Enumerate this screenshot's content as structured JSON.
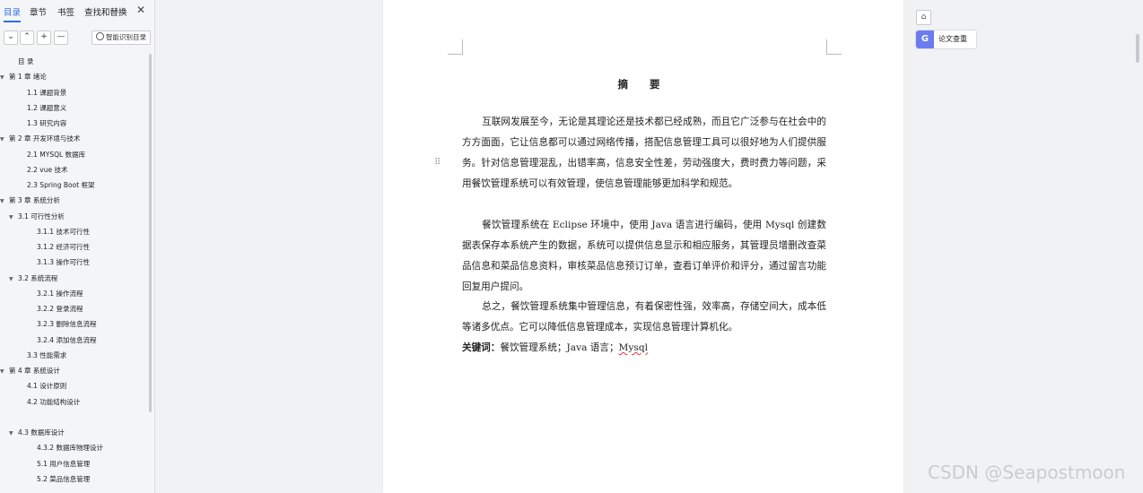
{
  "nav": {
    "tabs": [
      "目录",
      "章节",
      "书签",
      "查找和替换"
    ],
    "close_icon": "✕",
    "smart_button": "智能识别目录",
    "toc": [
      {
        "label": "目  录",
        "level": 1,
        "arrow": false
      },
      {
        "label": "第 1 章  绪论",
        "level": 0,
        "arrow": true
      },
      {
        "label": "1.1  课题背景",
        "level": 2,
        "arrow": false
      },
      {
        "label": "1.2  课题意义",
        "level": 2,
        "arrow": false
      },
      {
        "label": "1.3  研究内容",
        "level": 2,
        "arrow": false
      },
      {
        "label": "第 2 章  开发环境与技术",
        "level": 0,
        "arrow": true
      },
      {
        "label": "2.1 MYSQL 数据库",
        "level": 2,
        "arrow": false
      },
      {
        "label": "2.2 vue 技术",
        "level": 2,
        "arrow": false
      },
      {
        "label": "2.3 Spring Boot 框架",
        "level": 2,
        "arrow": false
      },
      {
        "label": "第 3 章  系统分析",
        "level": 0,
        "arrow": true
      },
      {
        "label": "3.1  可行性分析",
        "level": 1,
        "arrow": true
      },
      {
        "label": "3.1.1  技术可行性",
        "level": 3,
        "arrow": false
      },
      {
        "label": "3.1.2  经济可行性",
        "level": 3,
        "arrow": false
      },
      {
        "label": "3.1.3  操作可行性",
        "level": 3,
        "arrow": false
      },
      {
        "label": "3.2  系统流程",
        "level": 1,
        "arrow": true
      },
      {
        "label": "3.2.1  操作流程",
        "level": 3,
        "arrow": false
      },
      {
        "label": "3.2.2  登录流程",
        "level": 3,
        "arrow": false
      },
      {
        "label": "3.2.3  删除信息流程",
        "level": 3,
        "arrow": false
      },
      {
        "label": "3.2.4  添加信息流程",
        "level": 3,
        "arrow": false
      },
      {
        "label": "3.3  性能需求",
        "level": 2,
        "arrow": false
      },
      {
        "label": "第 4 章  系统设计",
        "level": 0,
        "arrow": true
      },
      {
        "label": "4.1  设计原则",
        "level": 2,
        "arrow": false
      },
      {
        "label": "4.2  功能结构设计",
        "level": 2,
        "arrow": false
      },
      {
        "label": "",
        "level": 2,
        "arrow": false
      },
      {
        "label": "4.3  数据库设计",
        "level": 1,
        "arrow": true
      },
      {
        "label": "4.3.2  数据库物理设计",
        "level": 3,
        "arrow": false
      },
      {
        "label": "5.1 用户信息管理",
        "level": 3,
        "arrow": false
      },
      {
        "label": "5.2  菜品信息管理",
        "level": 3,
        "arrow": false
      }
    ]
  },
  "document": {
    "title": "摘  要",
    "paragraphs": [
      "互联网发展至今，无论是其理论还是技术都已经成熟，而且它广泛参与在社会中的方方面面，它让信息都可以通过网络传播，搭配信息管理工具可以很好地为人们提供服务。针对信息管理混乱，出错率高，信息安全性差，劳动强度大，费时费力等问题，采用餐饮管理系统可以有效管理，使信息管理能够更加科学和规范。",
      "餐饮管理系统在 Eclipse 环境中，使用 Java 语言进行编码，使用 Mysql 创建数据表保存本系统产生的数据，系统可以提供信息显示和相应服务，其管理员增删改查菜品信息和菜品信息资料，审核菜品信息预订订单，查看订单评价和评分，通过留言功能回复用户提问。",
      "总之，餐饮管理系统集中管理信息，有着保密性强，效率高，存储空间大，成本低等诸多优点。它可以降低信息管理成本，实现信息管理计算机化。"
    ],
    "keywords_label": "关键词：",
    "keywords": "餐饮管理系统；Java 语言；",
    "keywords_last": "Mysql"
  },
  "right_panel": {
    "check_button": "论文查重",
    "check_icon": "G"
  },
  "watermark": "CSDN @Seapostmoon"
}
